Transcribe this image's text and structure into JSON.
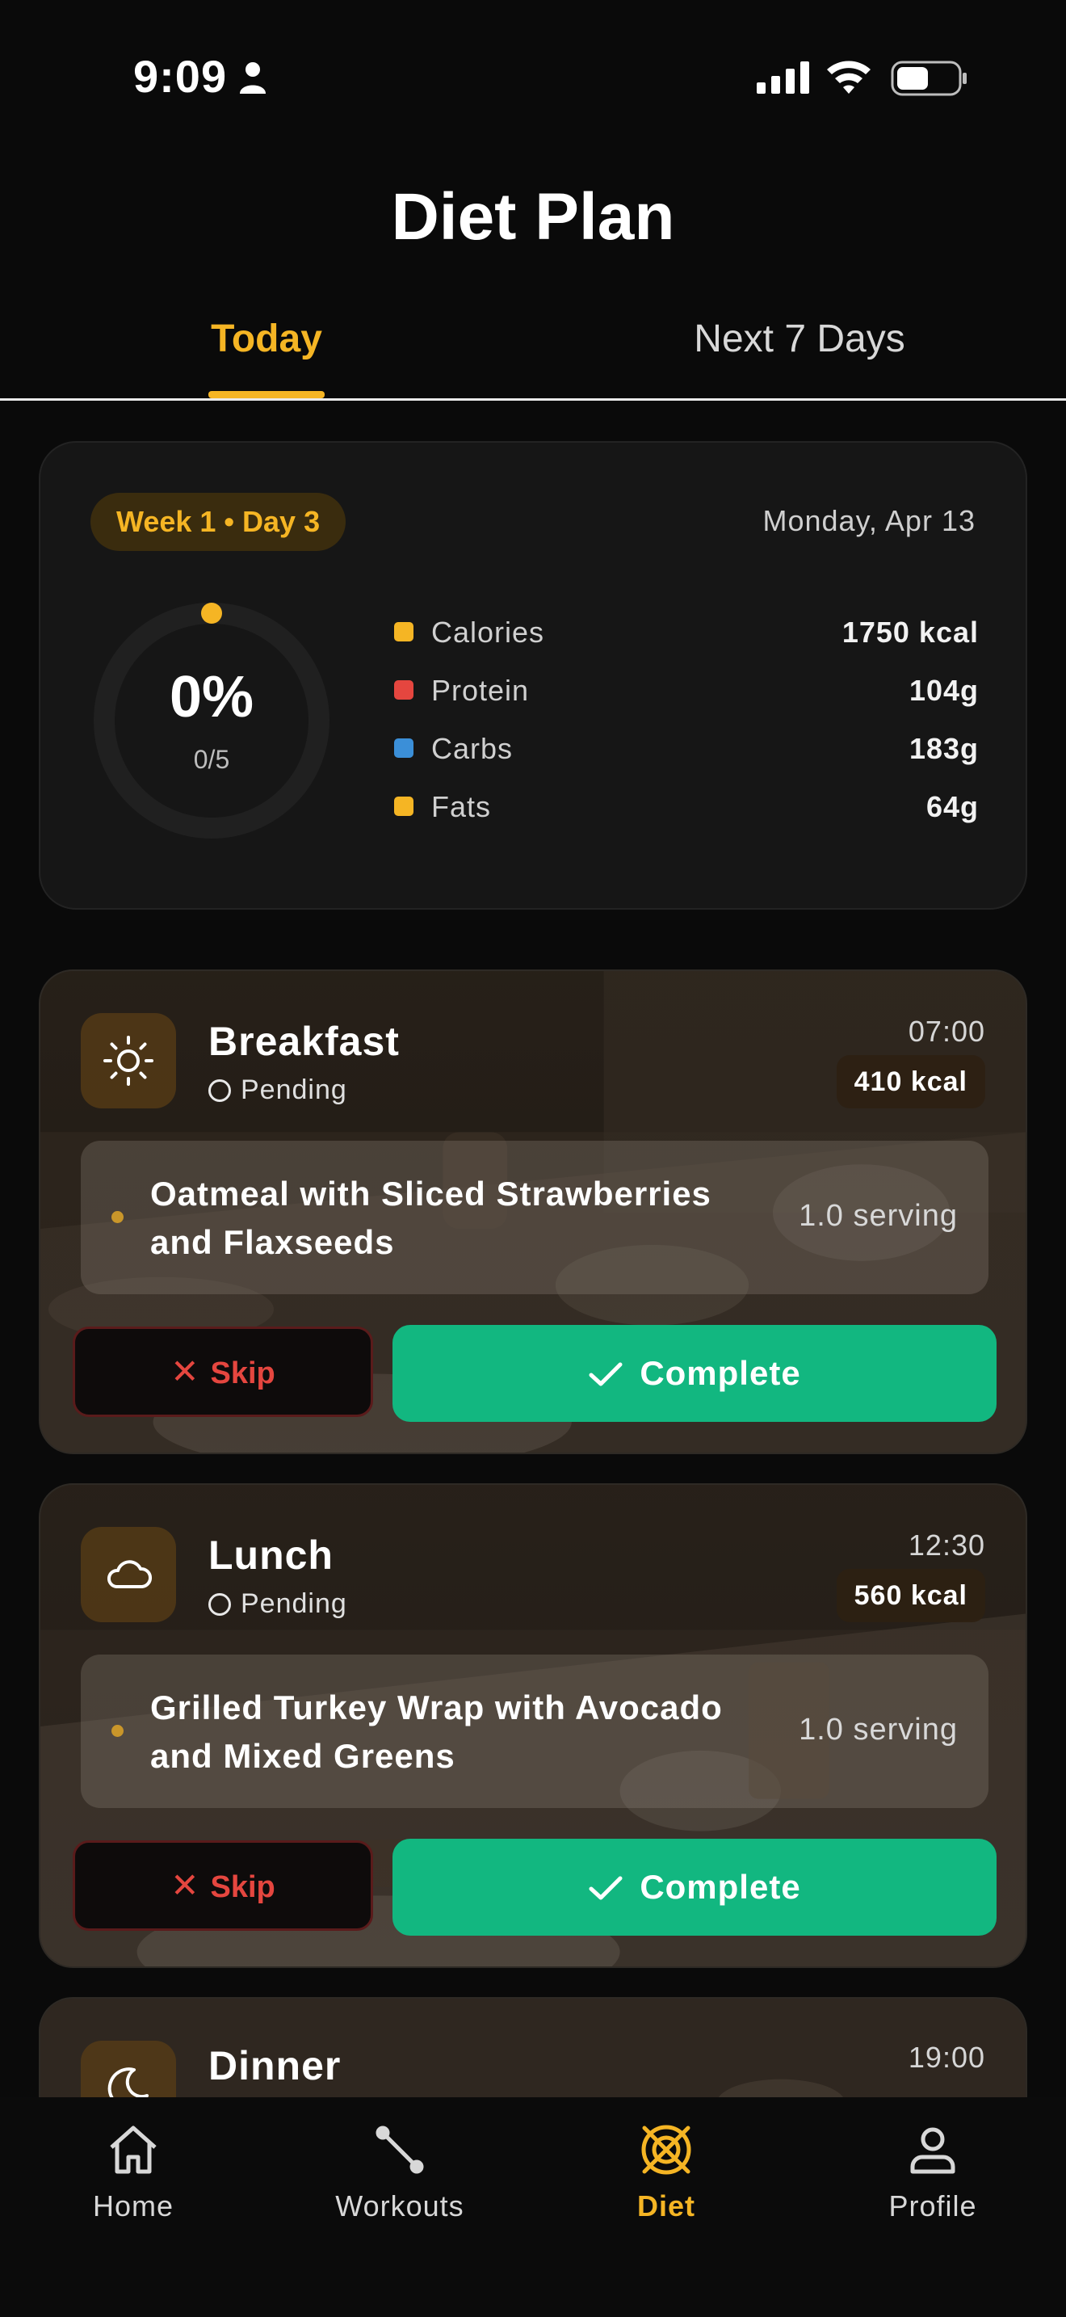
{
  "status_bar": {
    "time": "9:09"
  },
  "header": {
    "title": "Diet Plan"
  },
  "tabs": [
    {
      "label": "Today",
      "active": true
    },
    {
      "label": "Next 7 Days",
      "active": false
    }
  ],
  "summary": {
    "week_day": "Week 1 • Day 3",
    "date": "Monday, Apr 13",
    "progress_percent": "0%",
    "progress_fraction": 0,
    "progress_count": "0/5",
    "macros": [
      {
        "label": "Calories",
        "value": "1750 kcal",
        "color": "#f5b524"
      },
      {
        "label": "Protein",
        "value": "104g",
        "color": "#e5463f"
      },
      {
        "label": "Carbs",
        "value": "183g",
        "color": "#3b8fd8"
      },
      {
        "label": "Fats",
        "value": "64g",
        "color": "#f5b524"
      }
    ]
  },
  "meals": [
    {
      "title": "Breakfast",
      "icon": "sun-icon",
      "status": "Pending",
      "time": "07:00",
      "kcal": "410 kcal",
      "food": "Oatmeal with Sliced Strawberries and Flaxseeds",
      "serving": "1.0 serving",
      "skip_label": "Skip",
      "complete_label": "Complete"
    },
    {
      "title": "Lunch",
      "icon": "cloud-icon",
      "status": "Pending",
      "time": "12:30",
      "kcal": "560 kcal",
      "food": "Grilled Turkey Wrap with Avocado and Mixed Greens",
      "serving": "1.0 serving",
      "skip_label": "Skip",
      "complete_label": "Complete"
    },
    {
      "title": "Dinner",
      "icon": "moon-icon",
      "time": "19:00"
    }
  ],
  "nav": [
    {
      "label": "Home",
      "icon": "home-icon",
      "active": false
    },
    {
      "label": "Workouts",
      "icon": "dumbbell-icon",
      "active": false
    },
    {
      "label": "Diet",
      "icon": "diet-icon",
      "active": true
    },
    {
      "label": "Profile",
      "icon": "profile-icon",
      "active": false
    }
  ],
  "colors": {
    "accent": "#f5b524",
    "complete": "#12b780",
    "skip": "#e5463f",
    "background": "#0a0a0a"
  }
}
